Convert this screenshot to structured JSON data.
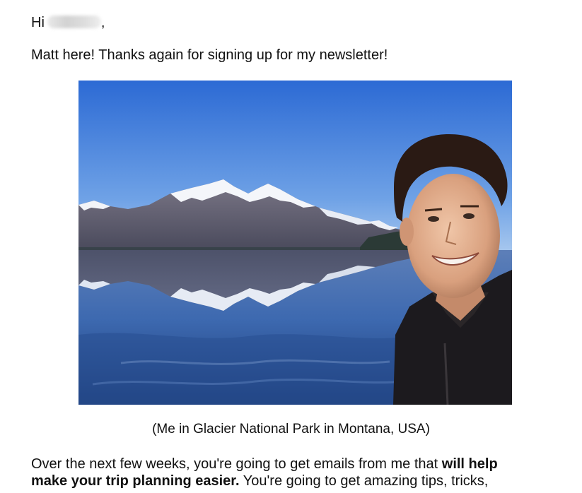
{
  "email": {
    "greeting_prefix": "Hi",
    "greeting_suffix": ",",
    "intro": "Matt here! Thanks again for signing up for my newsletter!",
    "caption": "(Me in Glacier National Park in Montana, USA)",
    "paragraph": {
      "line1_text": "Over the next few weeks, you're going to get emails from me that ",
      "line1_bold": "will help",
      "line2_bold": "make your trip planning easier.",
      "line2_text": " You're going to get amazing tips, tricks,"
    }
  },
  "colors": {
    "sky_top": "#2f6fd6",
    "sky_bottom": "#8fb8ea",
    "lake": "#3a67b0",
    "text": "#111111"
  }
}
